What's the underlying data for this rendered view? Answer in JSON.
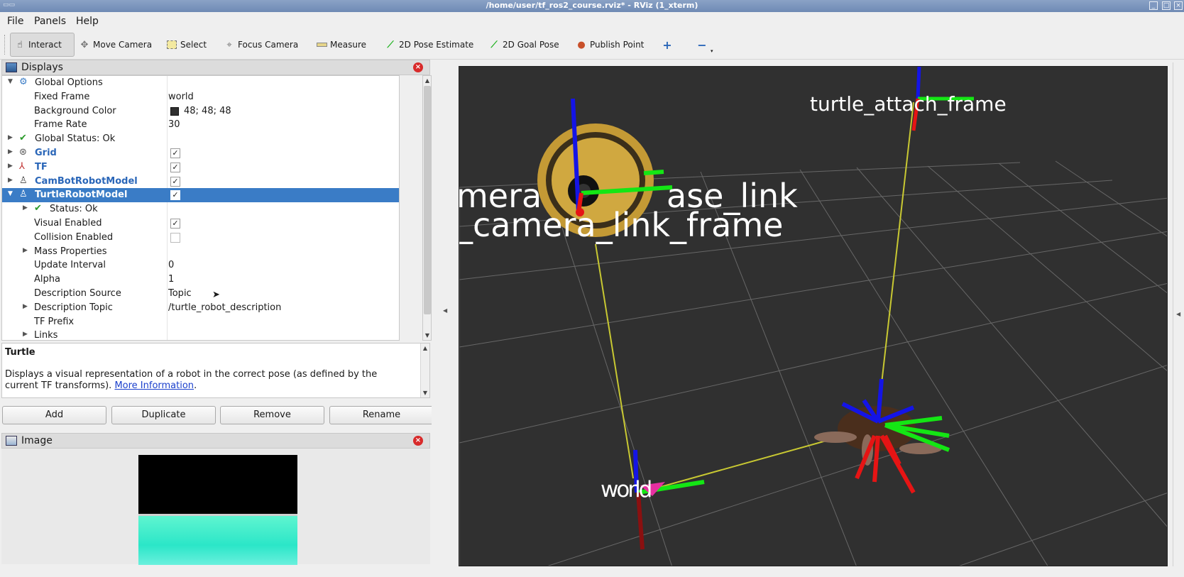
{
  "window": {
    "title": "/home/user/tf_ros2_course.rviz* - RViz (1_xterm)"
  },
  "menu": {
    "file": "File",
    "panels": "Panels",
    "help": "Help"
  },
  "toolbar": {
    "interact": "Interact",
    "move_camera": "Move Camera",
    "select": "Select",
    "focus_camera": "Focus Camera",
    "measure": "Measure",
    "pose_estimate": "2D Pose Estimate",
    "goal_pose": "2D Goal Pose",
    "publish_point": "Publish Point"
  },
  "displays": {
    "title": "Displays",
    "rows": [
      {
        "label": "Global Options",
        "value": ""
      },
      {
        "label": "Fixed Frame",
        "value": "world"
      },
      {
        "label": "Background Color",
        "value": "48; 48; 48"
      },
      {
        "label": "Frame Rate",
        "value": "30"
      },
      {
        "label": "Global Status: Ok",
        "value": ""
      },
      {
        "label": "Grid",
        "checked": true
      },
      {
        "label": "TF",
        "checked": true
      },
      {
        "label": "CamBotRobotModel",
        "checked": true
      },
      {
        "label": "TurtleRobotModel",
        "checked": true
      },
      {
        "label": "Status: Ok",
        "value": ""
      },
      {
        "label": "Visual Enabled",
        "checked": true
      },
      {
        "label": "Collision Enabled",
        "checked": false
      },
      {
        "label": "Mass Properties",
        "value": ""
      },
      {
        "label": "Update Interval",
        "value": "0"
      },
      {
        "label": "Alpha",
        "value": "1"
      },
      {
        "label": "Description Source",
        "value": "Topic"
      },
      {
        "label": "Description Topic",
        "value": "/turtle_robot_description"
      },
      {
        "label": "TF Prefix",
        "value": ""
      },
      {
        "label": "Links",
        "value": ""
      }
    ]
  },
  "description": {
    "title": "Turtle",
    "text": "Displays a visual representation of a robot in the correct pose (as defined by the current TF transforms).",
    "link": "More Information",
    "after_link": "."
  },
  "buttons": {
    "add": "Add",
    "duplicate": "Duplicate",
    "remove": "Remove",
    "rename": "Rename"
  },
  "image_panel": {
    "title": "Image"
  },
  "viewport": {
    "labels": {
      "turtle_attach_frame": "turtle_attach_frame",
      "camera_link_frame": "_camera_link_frame",
      "camera_partial": "mera",
      "base_link_partial": "ase_link",
      "world": "world"
    },
    "colors": {
      "background": "#303030",
      "grid": "#7a7a7a",
      "tf_line": "#c8c832"
    }
  }
}
